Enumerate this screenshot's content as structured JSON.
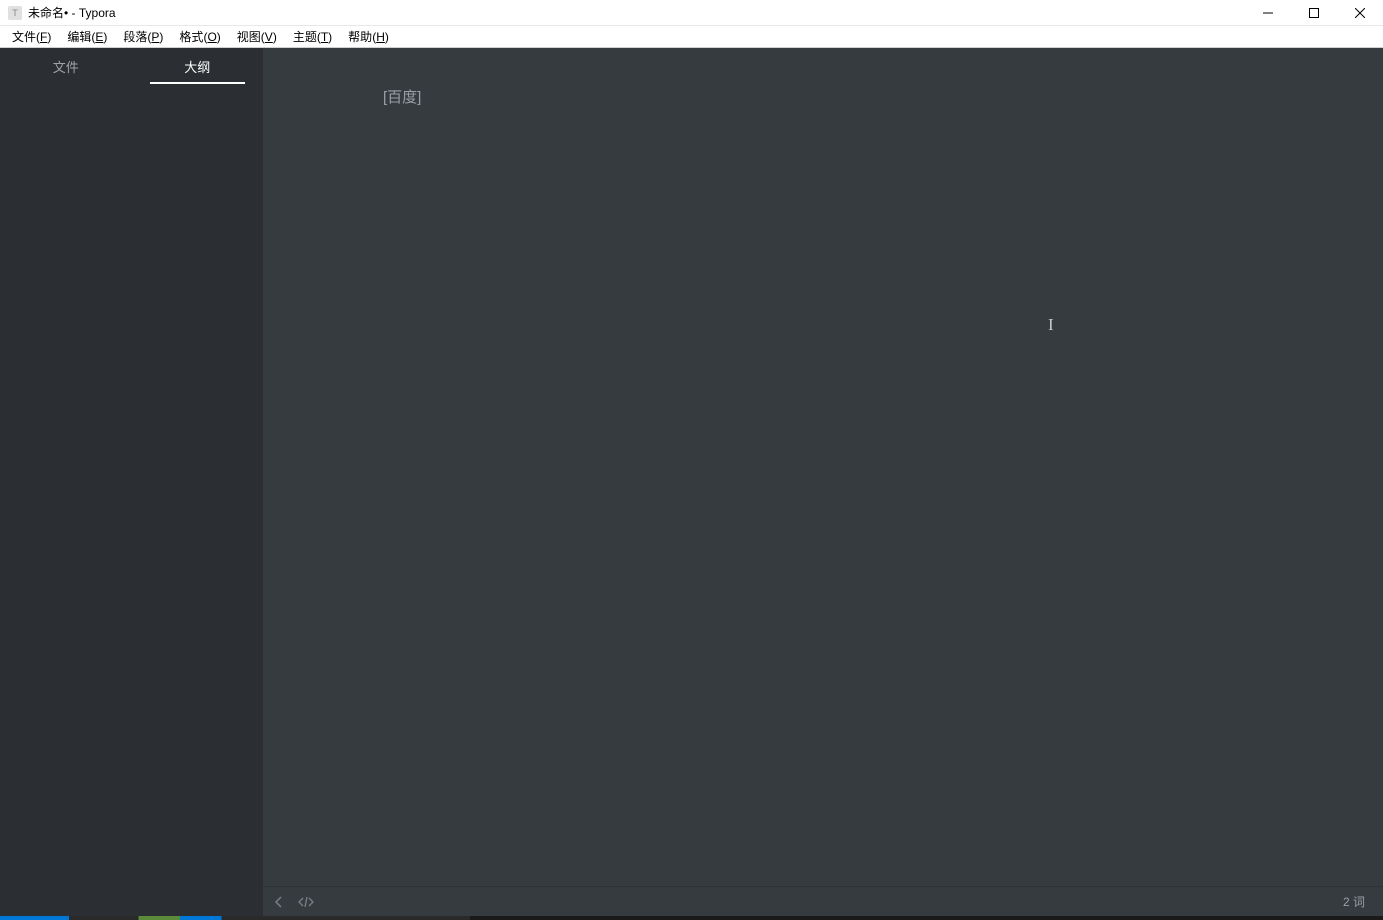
{
  "window": {
    "title": "未命名• - Typora",
    "app_icon_letter": "T"
  },
  "menubar": {
    "items": [
      {
        "label": "文件",
        "hotkey": "F"
      },
      {
        "label": "编辑",
        "hotkey": "E"
      },
      {
        "label": "段落",
        "hotkey": "P"
      },
      {
        "label": "格式",
        "hotkey": "O"
      },
      {
        "label": "视图",
        "hotkey": "V"
      },
      {
        "label": "主题",
        "hotkey": "T"
      },
      {
        "label": "帮助",
        "hotkey": "H"
      }
    ]
  },
  "sidebar": {
    "tabs": [
      {
        "label": "文件",
        "active": false
      },
      {
        "label": "大纲",
        "active": true
      }
    ]
  },
  "editor": {
    "content_text": "[百度]"
  },
  "statusbar": {
    "word_count": "2 词"
  }
}
